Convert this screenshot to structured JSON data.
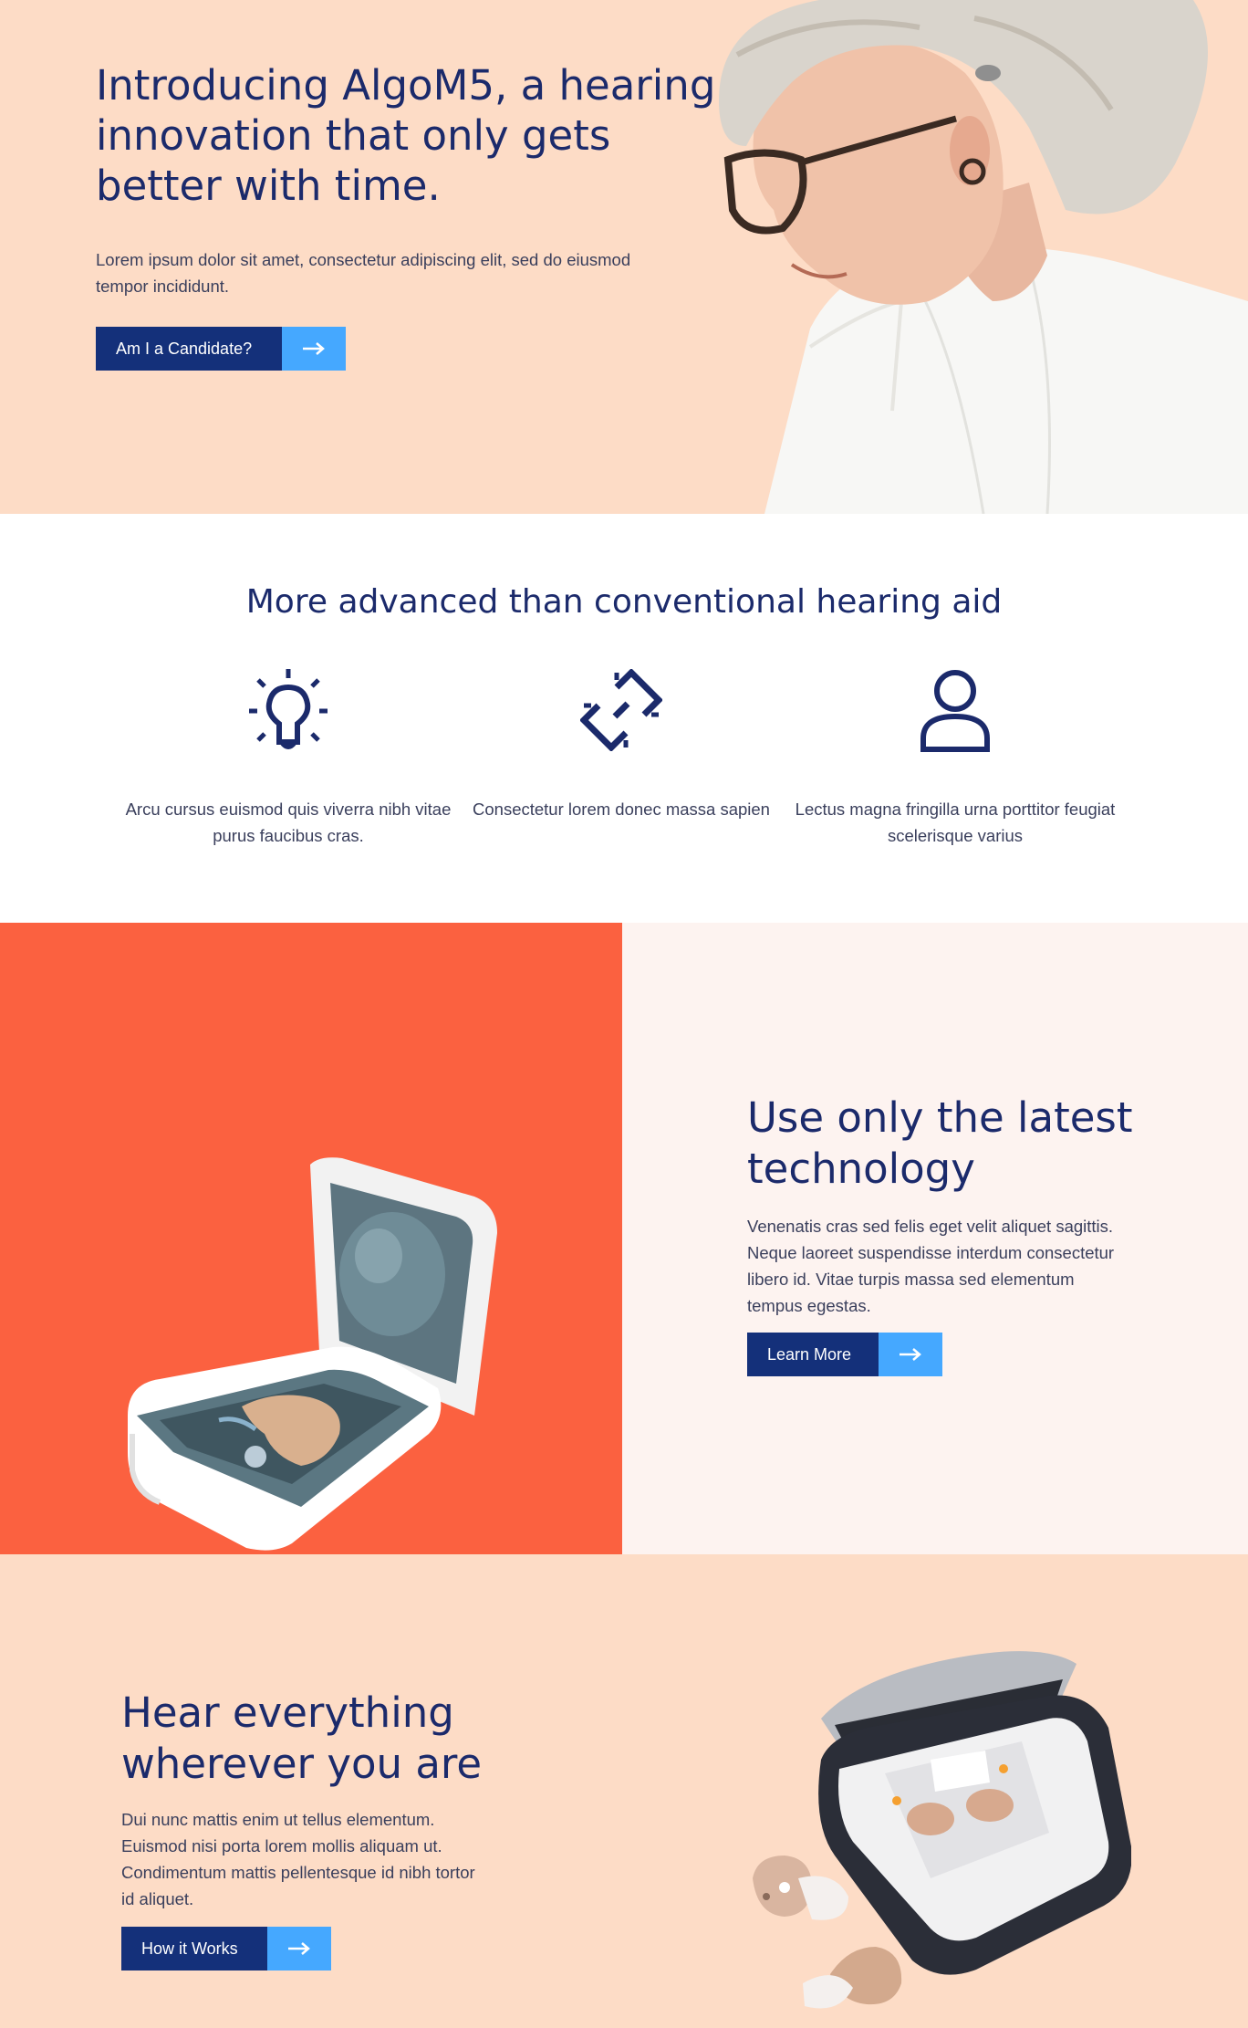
{
  "hero": {
    "title": "Introducing AlgoM5, a hearing innovation that only gets better with time.",
    "text": "Lorem ipsum dolor sit amet, consectetur adipiscing elit, sed do eiusmod tempor incididunt.",
    "cta_label": "Am I a Candidate?",
    "image": "smiling-woman-wearing-hearing-aid"
  },
  "features": {
    "title": "More advanced than conventional hearing aid",
    "items": [
      {
        "icon": "lightbulb-icon",
        "text": "Arcu cursus euismod quis viverra nibh vitae purus faucibus cras."
      },
      {
        "icon": "broken-link-icon",
        "text": "Consectetur lorem donec massa sapien"
      },
      {
        "icon": "user-icon",
        "text": "Lectus magna fringilla urna porttitor feugiat scelerisque varius"
      }
    ]
  },
  "tech": {
    "title": "Use only the latest technology",
    "text": "Venenatis cras sed felis eget velit aliquet sagittis. Neque laoreet suspendisse interdum consectetur libero id. Vitae turpis massa sed elementum tempus egestas.",
    "cta_label": "Learn More",
    "image": "hearing-aid-in-open-case"
  },
  "hear": {
    "title": "Hear everything wherever you are",
    "text": "Dui nunc mattis enim ut tellus elementum. Euismod nisi porta lorem mollis aliquam ut. Condimentum mattis pellentesque id nibh tortor id aliquet.",
    "cta_label": "How it Works",
    "image": "earbud-charging-case"
  },
  "colors": {
    "peach": "#fddcc6",
    "navy": "#1b2a6b",
    "button_navy": "#14307a",
    "arrow_blue": "#45a8ff",
    "coral": "#fb6140",
    "blush": "#fdf3f0"
  }
}
